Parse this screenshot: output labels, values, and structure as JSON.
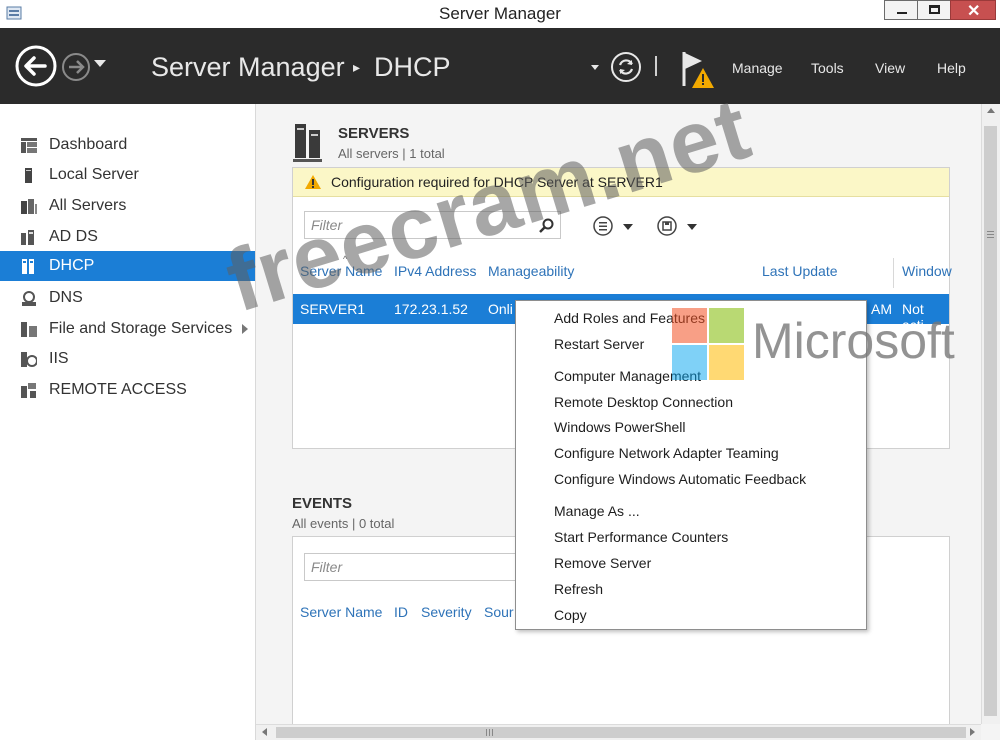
{
  "window": {
    "title": "Server Manager"
  },
  "header": {
    "breadcrumb_root": "Server Manager",
    "breadcrumb_separator": "▸",
    "breadcrumb_current": "DHCP",
    "menu": [
      "Manage",
      "Tools",
      "View",
      "Help"
    ]
  },
  "sidebar": {
    "items": [
      {
        "label": "Dashboard",
        "icon": "dashboard-icon"
      },
      {
        "label": "Local Server",
        "icon": "server-icon"
      },
      {
        "label": "All Servers",
        "icon": "servers-icon"
      },
      {
        "label": "AD DS",
        "icon": "ad-ds-icon"
      },
      {
        "label": "DHCP",
        "icon": "dhcp-icon",
        "selected": true
      },
      {
        "label": "DNS",
        "icon": "dns-icon"
      },
      {
        "label": "File and Storage Services",
        "icon": "file-storage-icon",
        "has_submenu": true
      },
      {
        "label": "IIS",
        "icon": "iis-icon"
      },
      {
        "label": "REMOTE ACCESS",
        "icon": "remote-access-icon"
      }
    ]
  },
  "servers": {
    "heading": "SERVERS",
    "subheading": "All servers | 1 total",
    "warning": "Configuration required for DHCP Server at SERVER1",
    "filter_placeholder": "Filter",
    "columns": [
      "Server Name",
      "IPv4 Address",
      "Manageability",
      "Last Update",
      "Window"
    ],
    "row": {
      "server_name": "SERVER1",
      "ipv4": "172.23.1.52",
      "manageability": "Onli",
      "last_update": "AM",
      "window": "Not acti"
    }
  },
  "events": {
    "heading": "EVENTS",
    "subheading": "All events | 0 total",
    "filter_placeholder": "Filter",
    "columns": [
      "Server Name",
      "ID",
      "Severity",
      "Sour"
    ]
  },
  "context_menu": {
    "items": [
      "Add Roles and Features",
      "Restart Server",
      "Computer Management",
      "Remote Desktop Connection",
      "Windows PowerShell",
      "Configure Network Adapter Teaming",
      "Configure Windows Automatic Feedback",
      "Manage As ...",
      "Start Performance Counters",
      "Remove Server",
      "Refresh",
      "Copy"
    ]
  },
  "watermark": {
    "site": "freecram.net",
    "brand": "Microsoft"
  },
  "colors": {
    "header_bg": "#2b2b2b",
    "selected_bg": "#1b7ed6",
    "warning_bg": "#fbf7c7",
    "link": "#2e73b8"
  }
}
